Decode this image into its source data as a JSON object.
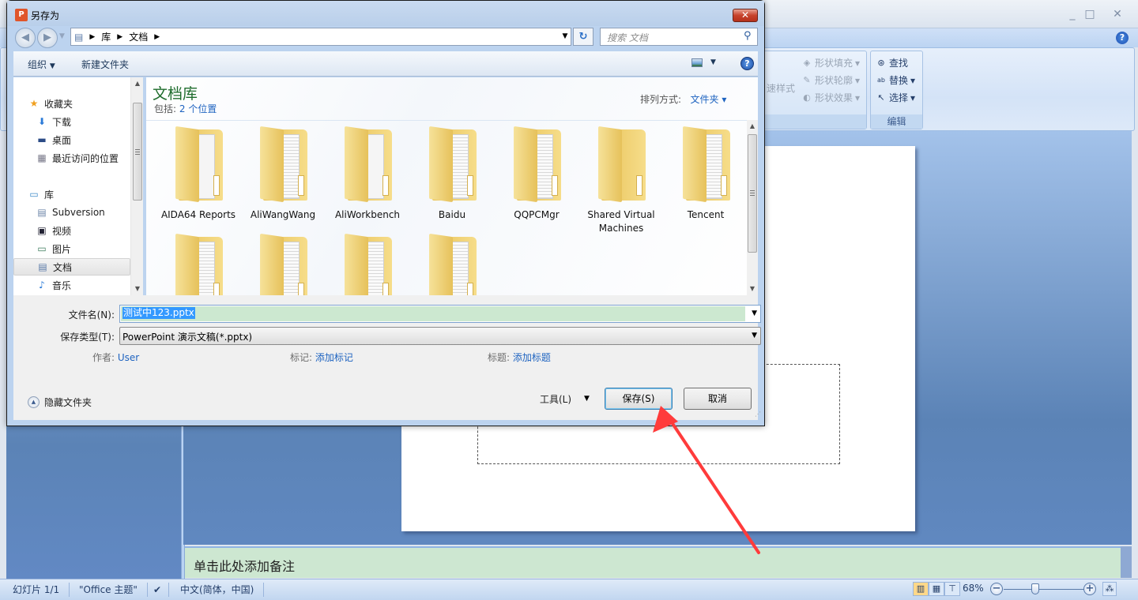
{
  "ppt": {
    "window_controls": [
      "_",
      "□",
      "✕"
    ],
    "ribbon": {
      "quick_styles_label": "速样式",
      "drawing_group": {
        "items": [
          {
            "label": "形状填充",
            "icon": "paint-bucket-icon",
            "enabled": false
          },
          {
            "label": "形状轮廓",
            "icon": "pencil-outline-icon",
            "enabled": false
          },
          {
            "label": "形状效果",
            "icon": "shape-effects-icon",
            "enabled": false
          }
        ]
      },
      "editing_group": {
        "label": "编辑",
        "items": [
          {
            "label": "查找",
            "icon": "binoculars-icon"
          },
          {
            "label": "替换",
            "icon": "replace-icon"
          },
          {
            "label": "选择",
            "icon": "cursor-icon"
          }
        ]
      }
    },
    "notes_placeholder": "单击此处添加备注",
    "statusbar": {
      "slide": "幻灯片 1/1",
      "theme": "\"Office 主题\"",
      "language": "中文(简体，中国)",
      "zoom": "68%",
      "zoom_fraction": 0.38
    }
  },
  "dialog": {
    "title": "另存为",
    "breadcrumb": [
      "库",
      "文档"
    ],
    "search_placeholder": "搜索 文档",
    "toolbar": {
      "organize": "组织",
      "new_folder": "新建文件夹"
    },
    "nav": {
      "favorites": "收藏夹",
      "favorites_items": [
        {
          "label": "下载",
          "icon": "download-folder-icon"
        },
        {
          "label": "桌面",
          "icon": "desktop-icon"
        },
        {
          "label": "最近访问的位置",
          "icon": "recent-places-icon"
        }
      ],
      "libraries": "库",
      "library_items": [
        {
          "label": "Subversion",
          "icon": "subversion-library-icon"
        },
        {
          "label": "视频",
          "icon": "video-icon"
        },
        {
          "label": "图片",
          "icon": "pictures-icon"
        },
        {
          "label": "文档",
          "icon": "documents-icon",
          "selected": true
        },
        {
          "label": "音乐",
          "icon": "music-icon"
        }
      ]
    },
    "content": {
      "library_title": "文档库",
      "includes_label": "包括:",
      "includes_value": "2 个位置",
      "arrange_label": "排列方式:",
      "arrange_value": "文件夹",
      "folders": [
        {
          "name": "AIDA64 Reports",
          "style": "plain"
        },
        {
          "name": "AliWangWang",
          "style": "full"
        },
        {
          "name": "AliWorkbench",
          "style": "plain"
        },
        {
          "name": "Baidu",
          "style": "full"
        },
        {
          "name": "QQPCMgr",
          "style": "full"
        },
        {
          "name": "Shared Virtual Machines",
          "style": "empty"
        },
        {
          "name": "Tencent",
          "style": "full"
        },
        {
          "name": "",
          "style": "full"
        },
        {
          "name": "",
          "style": "full"
        },
        {
          "name": "",
          "style": "full"
        },
        {
          "name": "",
          "style": "full"
        }
      ]
    },
    "filename_label": "文件名(N):",
    "filename_value": "测试中123.pptx",
    "filetype_label": "保存类型(T):",
    "filetype_value": "PowerPoint 演示文稿(*.pptx)",
    "author_label": "作者:",
    "author_value": "User",
    "tags_label": "标记:",
    "tags_value": "添加标记",
    "title_label": "标题:",
    "title_value": "添加标题",
    "hide_folders": "隐藏文件夹",
    "tools": "工具(L)",
    "save": "保存(S)",
    "cancel": "取消"
  },
  "annotation": {
    "type": "arrow",
    "color": "#ff3b3b",
    "target": "save-button"
  }
}
